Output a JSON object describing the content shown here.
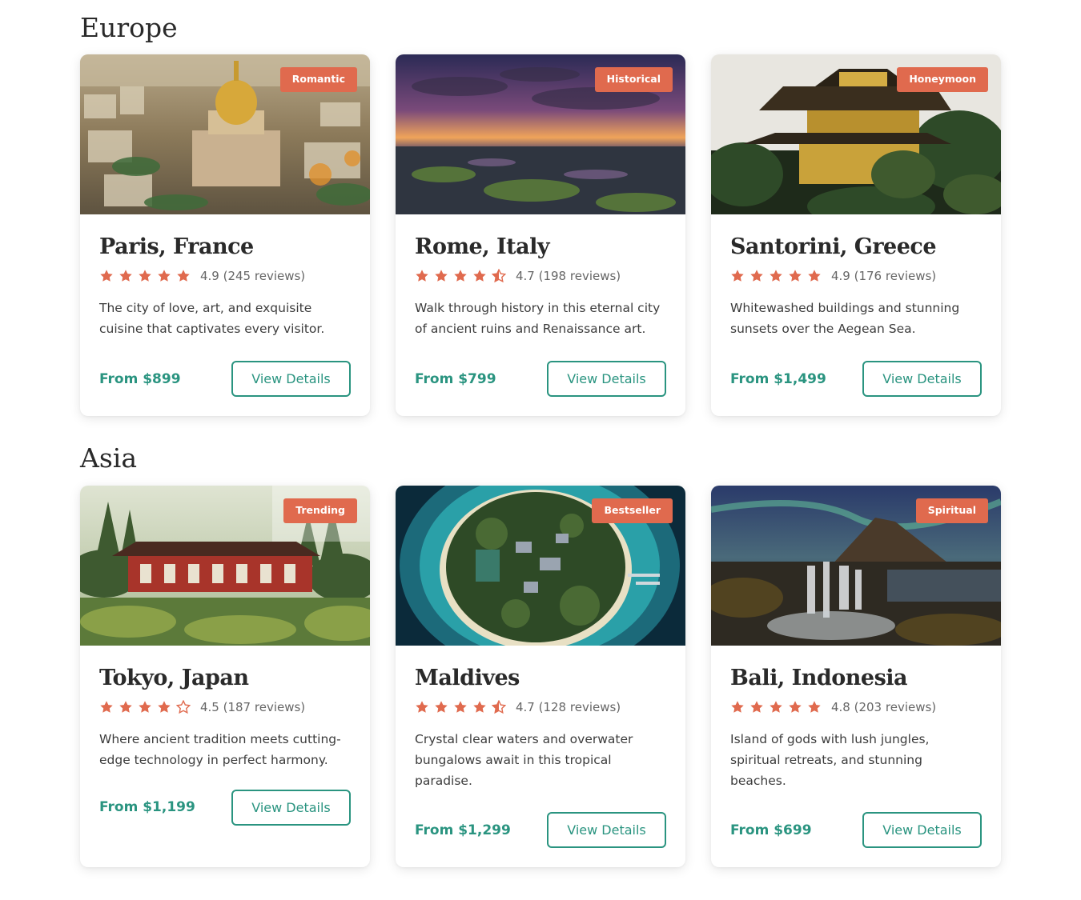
{
  "colors": {
    "accent_badge": "#e06a4e",
    "star": "#e06a4e",
    "price": "#2a9480",
    "button_border": "#2a9480",
    "heading": "#2a2a2a"
  },
  "sections": [
    {
      "title": "Europe",
      "cards": [
        {
          "badge": "Romantic",
          "title": "Paris, France",
          "rating_value": 4.9,
          "stars": [
            1,
            1,
            1,
            1,
            1
          ],
          "rating_text": "4.9 (245 reviews)",
          "description": "The city of love, art, and exquisite cuisine that captivates every visitor.",
          "price": "From $899",
          "button": "View Details",
          "image_icon": "paris-dome-image"
        },
        {
          "badge": "Historical",
          "title": "Rome, Italy",
          "rating_value": 4.7,
          "stars": [
            1,
            1,
            1,
            1,
            0.5
          ],
          "rating_text": "4.7 (198 reviews)",
          "description": "Walk through history in this eternal city of ancient ruins and Renaissance art.",
          "price": "From $799",
          "button": "View Details",
          "image_icon": "sunset-coast-image"
        },
        {
          "badge": "Honeymoon",
          "title": "Santorini, Greece",
          "rating_value": 4.9,
          "stars": [
            1,
            1,
            1,
            1,
            1
          ],
          "rating_text": "4.9 (176 reviews)",
          "description": "Whitewashed buildings and stunning sunsets over the Aegean Sea.",
          "price": "From $1,499",
          "button": "View Details",
          "image_icon": "golden-pagoda-image"
        }
      ]
    },
    {
      "title": "Asia",
      "cards": [
        {
          "badge": "Trending",
          "title": "Tokyo, Japan",
          "rating_value": 4.5,
          "stars": [
            1,
            1,
            1,
            1,
            0
          ],
          "rating_text": "4.5 (187 reviews)",
          "description": "Where ancient tradition meets cutting-edge technology in perfect harmony.",
          "price": "From $1,199",
          "button": "View Details",
          "image_icon": "japanese-temple-image"
        },
        {
          "badge": "Bestseller",
          "title": "Maldives",
          "rating_value": 4.7,
          "stars": [
            1,
            1,
            1,
            1,
            0.5
          ],
          "rating_text": "4.7 (128 reviews)",
          "description": "Crystal clear waters and overwater bungalows await in this tropical paradise.",
          "price": "From $1,299",
          "button": "View Details",
          "image_icon": "island-aerial-image"
        },
        {
          "badge": "Spiritual",
          "title": "Bali, Indonesia",
          "rating_value": 4.8,
          "stars": [
            1,
            1,
            1,
            1,
            1
          ],
          "rating_text": "4.8 (203 reviews)",
          "description": "Island of gods with lush jungles, spiritual retreats, and stunning beaches.",
          "price": "From $699",
          "button": "View Details",
          "image_icon": "waterfall-mountain-image"
        }
      ]
    }
  ]
}
